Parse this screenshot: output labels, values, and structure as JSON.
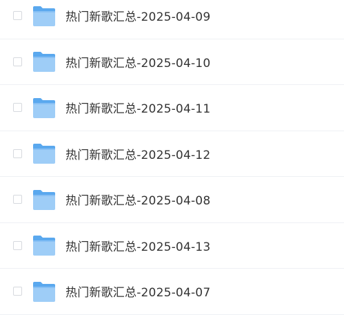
{
  "file_list": {
    "items": [
      {
        "name": "热门新歌汇总-2025-04-09",
        "icon": "folder-icon"
      },
      {
        "name": "热门新歌汇总-2025-04-10",
        "icon": "folder-icon"
      },
      {
        "name": "热门新歌汇总-2025-04-11",
        "icon": "folder-icon"
      },
      {
        "name": "热门新歌汇总-2025-04-12",
        "icon": "folder-icon"
      },
      {
        "name": "热门新歌汇总-2025-04-08",
        "icon": "folder-icon"
      },
      {
        "name": "热门新歌汇总-2025-04-13",
        "icon": "folder-icon"
      },
      {
        "name": "热门新歌汇总-2025-04-07",
        "icon": "folder-icon"
      }
    ]
  },
  "colors": {
    "folder_light": "#9ecdf7",
    "folder_dark": "#5aa8ee",
    "text": "#333333",
    "divider": "#eef0f4"
  }
}
